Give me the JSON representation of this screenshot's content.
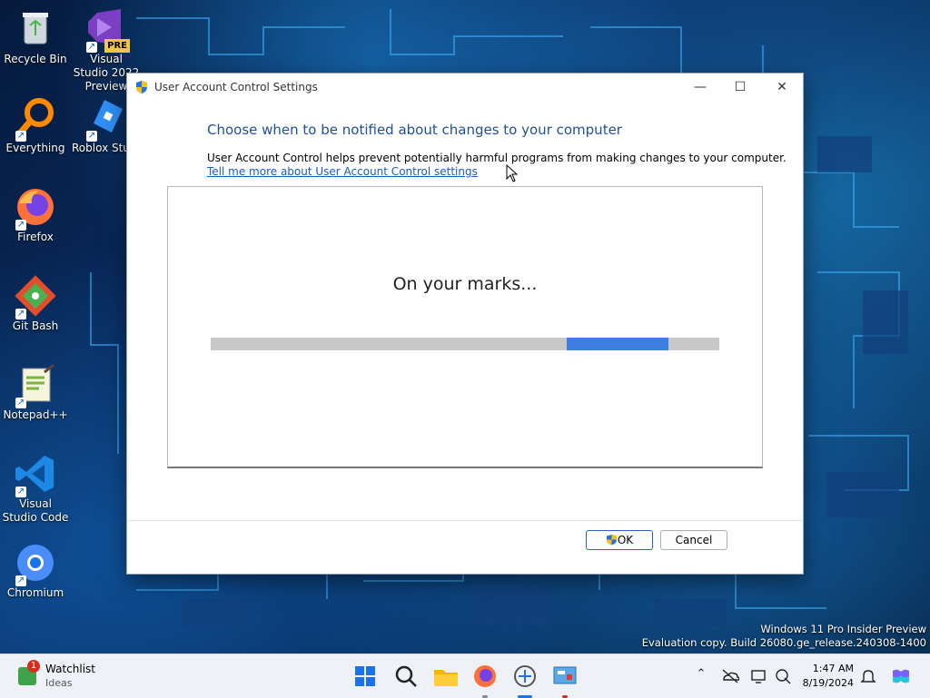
{
  "desktop": {
    "icons": [
      {
        "label": "Recycle Bin"
      },
      {
        "label": "Visual Studio 2022 Preview",
        "badge": "PRE"
      },
      {
        "label": "Everything"
      },
      {
        "label": "Roblox Studio"
      },
      {
        "label": "Firefox"
      },
      {
        "label": "Git Bash"
      },
      {
        "label": "Notepad++"
      },
      {
        "label": "Visual Studio Code"
      },
      {
        "label": "Chromium"
      }
    ],
    "watermark": {
      "line1": "Windows 11 Pro Insider Preview",
      "line2": "Evaluation copy. Build 26080.ge_release.240308-1400"
    }
  },
  "dialog": {
    "title": "User Account Control Settings",
    "heading": "Choose when to be notified about changes to your computer",
    "description": "User Account Control helps prevent potentially harmful programs from making changes to your computer.",
    "link": "Tell me more about User Account Control settings",
    "status": "On your marks...",
    "progress": {
      "chunk_start": 0.7,
      "chunk_end": 0.9
    },
    "ok_label": "OK",
    "cancel_label": "Cancel",
    "colors": {
      "heading": "#1f4e9c",
      "link": "#1a5bbf",
      "accent": "#3c7fe0"
    }
  },
  "taskbar": {
    "widget": {
      "badge": "1",
      "title": "Watchlist",
      "subtitle": "Ideas"
    },
    "apps": [
      "start-icon",
      "search-icon",
      "file-explorer-icon",
      "firefox-icon",
      "uac-icon",
      "control-panel-icon"
    ],
    "clock": {
      "time": "1:47 AM",
      "date": "8/19/2024"
    },
    "tray_icons": [
      "chevron-up-icon",
      "onedrive-icon",
      "display-icon",
      "network-icon",
      "notification-icon",
      "copilot-icon"
    ]
  }
}
